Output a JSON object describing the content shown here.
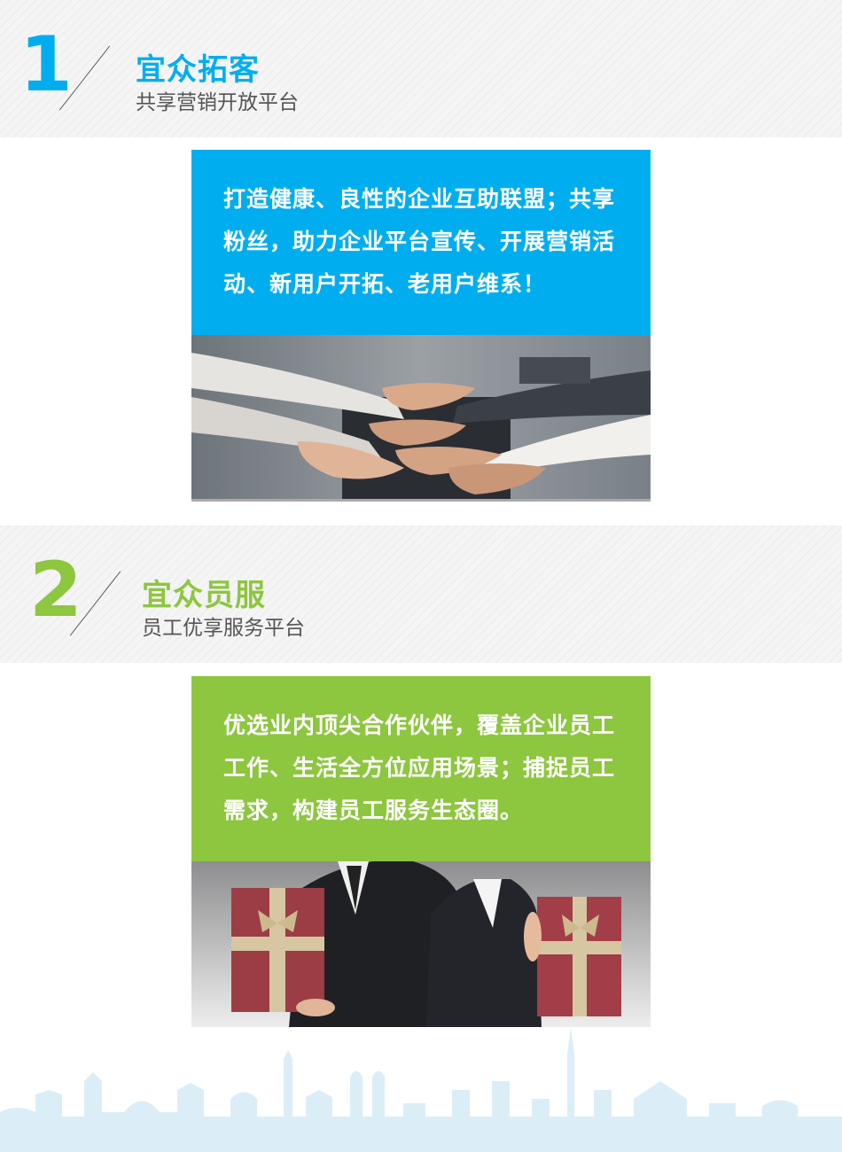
{
  "sections": [
    {
      "number": "1",
      "title": "宜众拓客",
      "subtitle": "共享营销开放平台",
      "accent": "#00aeef",
      "text": "打造健康、良性的企业互助联盟；共享粉丝，助力企业平台宣传、开展营销活动、新用户开拓、老用户维系！"
    },
    {
      "number": "2",
      "title": "宜众员服",
      "subtitle": "员工优享服务平台",
      "accent": "#8dc63f",
      "text": "优选业内顶尖合作伙伴，覆盖企业员工工作、生活全方位应用场景；捕捉员工需求，构建员工服务生态圈。"
    }
  ]
}
